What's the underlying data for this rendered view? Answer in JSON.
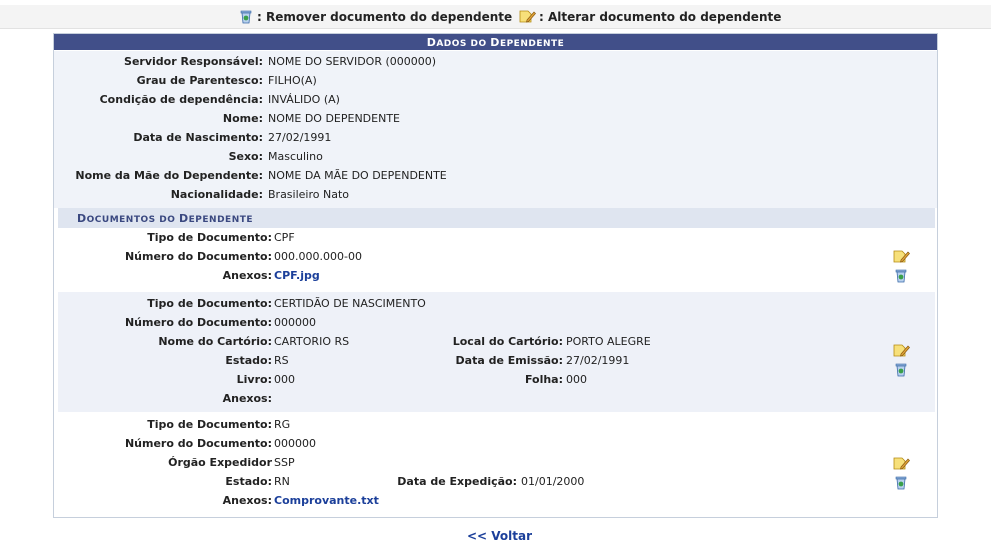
{
  "legend": {
    "remove_label": ": Remover documento do dependente",
    "edit_label": ": Alterar documento do dependente"
  },
  "panel": {
    "title_first": "D",
    "title_rest_1": "ADOS DO ",
    "title_first_2": "D",
    "title_rest_2": "EPENDENTE",
    "fields": [
      {
        "label": "Servidor Responsável:",
        "value": "NOME DO SERVIDOR (000000)"
      },
      {
        "label": "Grau de Parentesco:",
        "value": "FILHO(A)"
      },
      {
        "label": "Condição de dependência:",
        "value": "INVÁLIDO (A)"
      },
      {
        "label": "Nome:",
        "value": "NOME DO DEPENDENTE"
      },
      {
        "label": "Data de Nascimento:",
        "value": "27/02/1991"
      },
      {
        "label": "Sexo:",
        "value": "Masculino"
      },
      {
        "label": "Nome da Mãe do Dependente:",
        "value": "NOME DA MÃE DO DEPENDENTE"
      },
      {
        "label": "Nacionalidade:",
        "value": "Brasileiro Nato"
      }
    ]
  },
  "documents": {
    "section_first": "D",
    "section_rest_1": "OCUMENTOS DO ",
    "section_first_2": "D",
    "section_rest_2": "EPENDENTE",
    "doc1": {
      "tipo_label": "Tipo de Documento:",
      "tipo": "CPF",
      "numero_label": "Número do Documento:",
      "numero": "000.000.000-00",
      "anexos_label": "Anexos:",
      "anexo": "CPF.jpg"
    },
    "doc2": {
      "tipo_label": "Tipo de Documento:",
      "tipo": "CERTIDÃO DE NASCIMENTO",
      "numero_label": "Número do Documento:",
      "numero": "000000",
      "cartorio_label": "Nome do Cartório:",
      "cartorio": "CARTORIO RS",
      "local_label": "Local do Cartório:",
      "local": "PORTO ALEGRE",
      "estado_label": "Estado:",
      "estado": "RS",
      "emissao_label": "Data de Emissão:",
      "emissao": "27/02/1991",
      "livro_label": "Livro:",
      "livro": "000",
      "folha_label": "Folha:",
      "folha": "000",
      "anexos_label": "Anexos:"
    },
    "doc3": {
      "tipo_label": "Tipo de Documento:",
      "tipo": "RG",
      "numero_label": "Número do Documento:",
      "numero": "000000",
      "orgao_label": "Órgão Expedidor",
      "orgao": "SSP",
      "estado_label": "Estado:",
      "estado": "RN",
      "expedicao_label": "Data de Expedição:",
      "expedicao": "01/01/2000",
      "anexos_label": "Anexos:",
      "anexo": "Comprovante.txt"
    }
  },
  "footer": {
    "back_label": "<< Voltar"
  },
  "icons": {
    "edit": "edit-document-icon",
    "remove": "trash-can-icon"
  },
  "colors": {
    "caption_bg": "#414f89",
    "link": "#1b3f9a",
    "subcaption_bg": "#dfe5f0",
    "alt_row_bg": "#eef1f8"
  }
}
